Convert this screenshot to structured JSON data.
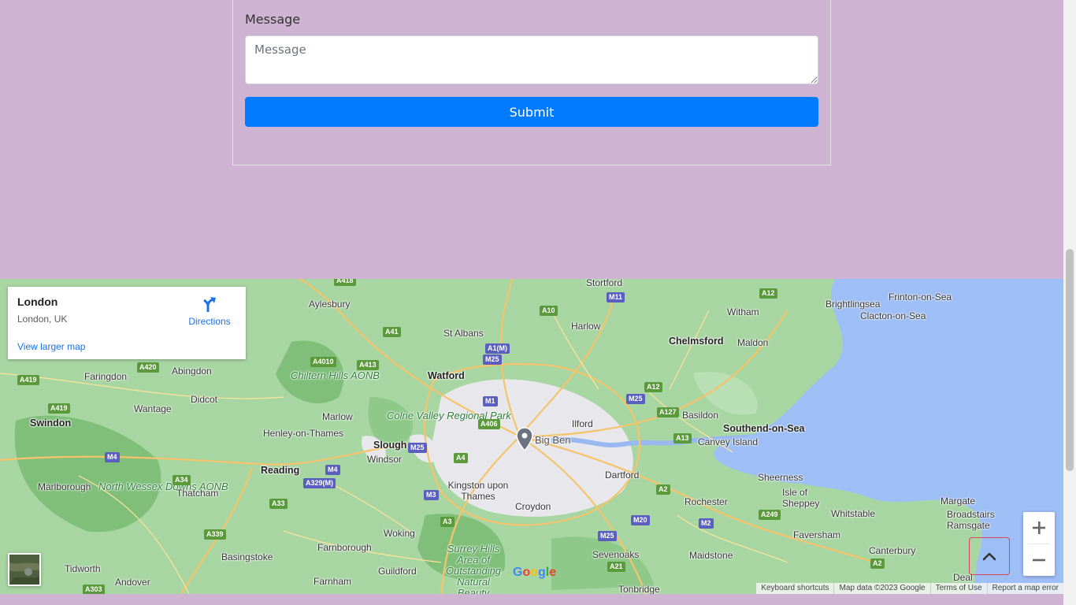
{
  "form": {
    "message_label": "Message",
    "message_placeholder": "Message",
    "submit_label": "Submit"
  },
  "map": {
    "info": {
      "title": "London",
      "address": "London, UK",
      "directions": "Directions",
      "larger_map": "View larger map"
    },
    "marker_label": "Big Ben",
    "brand": "Google",
    "attribution": {
      "shortcuts": "Keyboard shortcuts",
      "data": "Map data ©2023 Google",
      "terms": "Terms of Use",
      "report": "Report a map error"
    },
    "places": [
      "Stortford",
      "Aylesbury",
      "Witham",
      "Brightlingsea",
      "Frinton-on-Sea",
      "Clacton-on-Sea",
      "Harlow",
      "St Albans",
      "Chelmsford",
      "Maldon",
      "Abingdon",
      "Faringdon",
      "Watford",
      "Chiltern Hills AONB",
      "Didcot",
      "Wantage",
      "Swindon",
      "Marlow",
      "Colne Valley Regional Park",
      "Basildon",
      "Henley-on-Thames",
      "Ilford",
      "Southend-on-Sea",
      "Canvey Island",
      "Slough",
      "Windsor",
      "Reading",
      "Dartford",
      "Marlborough",
      "North Wessex Downs AONB",
      "Thatcham",
      "Kingston upon Thames",
      "Sheerness",
      "Isle of Sheppey",
      "Rochester",
      "Margate",
      "Broadstairs",
      "Ramsgate",
      "Croydon",
      "Whitstable",
      "Faversham",
      "Woking",
      "Basingstoke",
      "Farnborough",
      "Canterbury",
      "Surrey Hills Area of Outstanding Natural Beauty",
      "Sevenoaks",
      "Maidstone",
      "Tidworth",
      "Andover",
      "Guildford",
      "Farnham",
      "Deal",
      "Tonbridge"
    ],
    "roads": [
      "A418",
      "M11",
      "A12",
      "A10",
      "A41",
      "A1(M)",
      "M25",
      "A4010",
      "A413",
      "A420",
      "A419",
      "A419",
      "M1",
      "A406",
      "M25",
      "A12",
      "A127",
      "M4",
      "M25",
      "A13",
      "M4",
      "A4",
      "A34",
      "A329(M)",
      "M3",
      "A33",
      "A2",
      "M20",
      "M2",
      "A3",
      "A339",
      "A249",
      "M25",
      "A21",
      "A2",
      "A303"
    ]
  },
  "colors": {
    "page_bg": "#cfb3d2",
    "submit_bg": "#007bff",
    "scroll_top_border": "#e0405a"
  },
  "icons": [
    "directions-icon",
    "plus-icon",
    "minus-icon",
    "chevron-up-icon",
    "map-pin-icon",
    "satellite-thumbnail"
  ]
}
